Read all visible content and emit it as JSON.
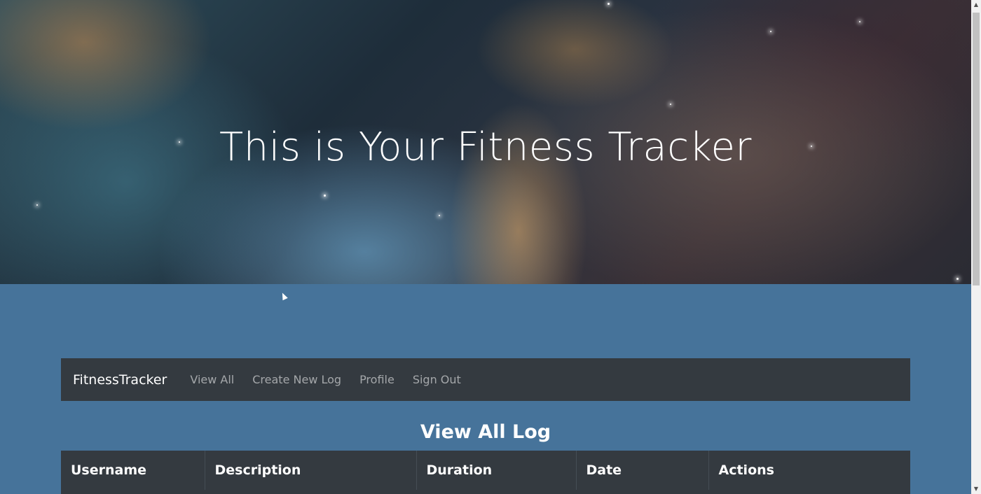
{
  "hero": {
    "title": "This is Your Fitness Tracker"
  },
  "navbar": {
    "brand": "FitnessTracker",
    "links": [
      "View All",
      "Create New Log",
      "Profile",
      "Sign Out"
    ]
  },
  "main": {
    "section_title": "View All Log",
    "table": {
      "columns": [
        "Username",
        "Description",
        "Duration",
        "Date",
        "Actions"
      ]
    }
  },
  "colors": {
    "page_background": "#46739a",
    "navbar_background": "#343a40",
    "table_header_background": "#343a40"
  }
}
